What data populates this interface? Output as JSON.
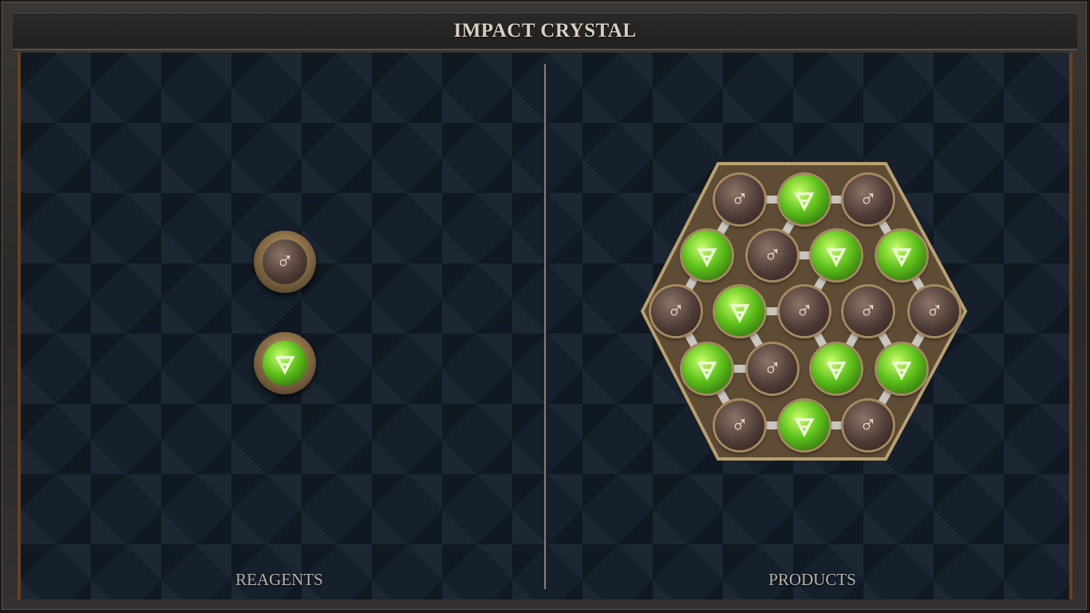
{
  "title": "IMPACT CRYSTAL",
  "sections": {
    "reagents_label": "REAGENTS",
    "products_label": "PRODUCTS"
  },
  "reagents": [
    {
      "element": "salt-metal",
      "symbol": "♂"
    },
    {
      "element": "earth",
      "symbol": "🜃"
    }
  ],
  "product": {
    "atoms": [
      {
        "element": "metal",
        "symbol": "♂"
      },
      {
        "element": "earth",
        "symbol": "🜃"
      },
      {
        "element": "metal",
        "symbol": "♂"
      },
      {
        "element": "earth",
        "symbol": "🜃"
      },
      {
        "element": "metal",
        "symbol": "♂"
      },
      {
        "element": "earth",
        "symbol": "🜃"
      },
      {
        "element": "earth",
        "symbol": "🜃"
      },
      {
        "element": "metal",
        "symbol": "♂"
      },
      {
        "element": "earth",
        "symbol": "🜃"
      },
      {
        "element": "metal",
        "symbol": "♂"
      },
      {
        "element": "metal",
        "symbol": "♂"
      },
      {
        "element": "metal",
        "symbol": "♂"
      },
      {
        "element": "earth",
        "symbol": "🜃"
      },
      {
        "element": "metal",
        "symbol": "♂"
      },
      {
        "element": "earth",
        "symbol": "🜃"
      },
      {
        "element": "earth",
        "symbol": "🜃"
      },
      {
        "element": "metal",
        "symbol": "♂"
      },
      {
        "element": "earth",
        "symbol": "🜃"
      },
      {
        "element": "metal",
        "symbol": "♂"
      }
    ]
  },
  "colors": {
    "accent": "#d8d0c2",
    "earth": "#5fc21c",
    "metal": "#4e3c36",
    "frame_trim": "#6a3f22"
  }
}
